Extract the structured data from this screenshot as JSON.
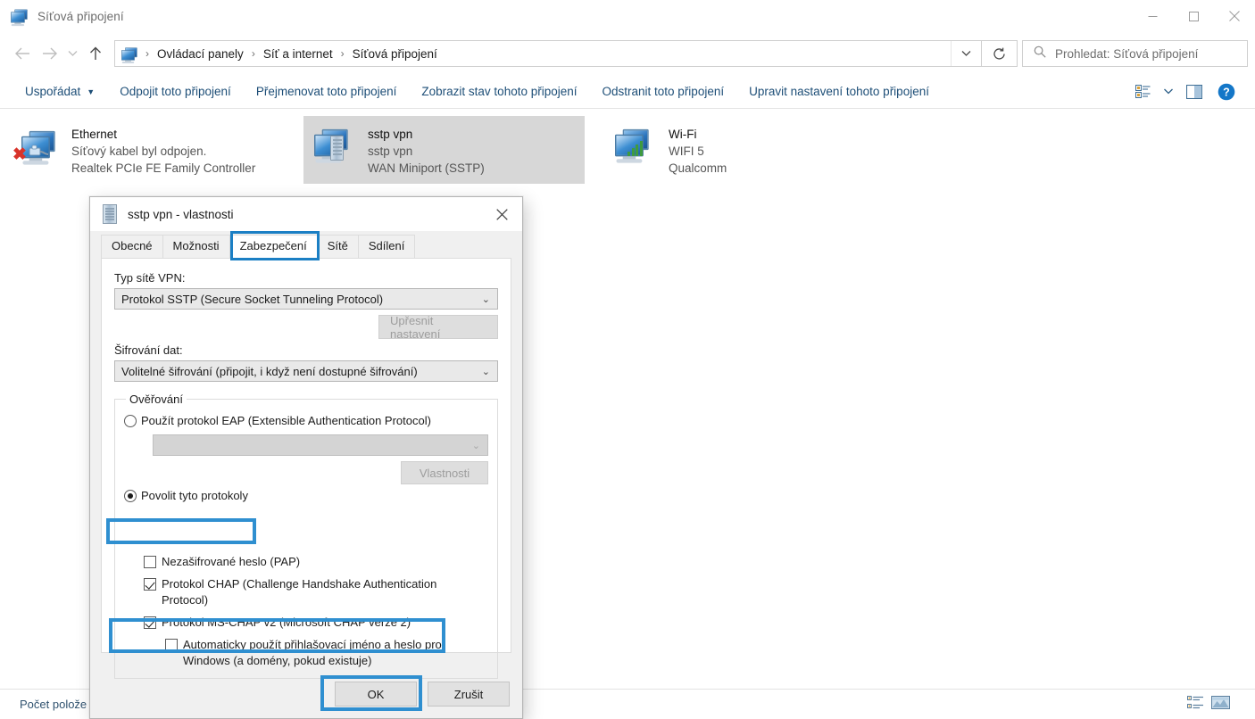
{
  "window": {
    "title": "Síťová připojení",
    "icon": "network-connections-icon",
    "minimize": "minimize-icon",
    "maximize": "maximize-icon",
    "close": "close-icon"
  },
  "address_bar": {
    "back": "back-arrow-icon",
    "forward": "forward-arrow-icon",
    "recent": "chevron-down-icon",
    "up": "up-arrow-icon",
    "crumbs": [
      "Ovládací panely",
      "Síť a internet",
      "Síťová připojení"
    ],
    "separator": "›",
    "dropdown": "chevron-down-icon",
    "refresh": "refresh-icon"
  },
  "search": {
    "icon": "search-icon",
    "placeholder": "Prohledat: Síťová připojení"
  },
  "command_bar": {
    "items": [
      {
        "label": "Uspořádat",
        "has_caret": true
      },
      {
        "label": "Odpojit toto připojení",
        "has_caret": false
      },
      {
        "label": "Přejmenovat toto připojení",
        "has_caret": false
      },
      {
        "label": "Zobrazit stav tohoto připojení",
        "has_caret": false
      },
      {
        "label": "Odstranit toto připojení",
        "has_caret": false
      },
      {
        "label": "Upravit nastavení tohoto připojení",
        "has_caret": false
      }
    ],
    "view_icon": "change-view-icon",
    "view_caret": "chevron-down-icon",
    "pane_icon": "preview-pane-icon",
    "help_icon": "help-icon"
  },
  "connections": [
    {
      "name": "Ethernet",
      "status": "Síťový kabel byl odpojen.",
      "device": "Realtek PCIe FE Family Controller",
      "icon": "network-adapter-disconnected-icon",
      "selected": false
    },
    {
      "name": "sstp vpn",
      "status": "sstp vpn",
      "device": "WAN Miniport (SSTP)",
      "icon": "vpn-connection-icon",
      "selected": true
    },
    {
      "name": "Wi-Fi",
      "status": "WIFI 5",
      "device": "Qualcomm",
      "icon": "wifi-connection-icon",
      "selected": false
    }
  ],
  "status_bar": {
    "text": "Počet polože",
    "details_view_icon": "details-view-icon",
    "tiles_view_icon": "tiles-view-icon"
  },
  "dialog": {
    "title": "sstp vpn - vlastnosti",
    "icon": "vpn-server-icon",
    "close": "close-icon",
    "tabs": [
      {
        "label": "Obecné",
        "active": false
      },
      {
        "label": "Možnosti",
        "active": false
      },
      {
        "label": "Zabezpečení",
        "active": true
      },
      {
        "label": "Sítě",
        "active": false
      },
      {
        "label": "Sdílení",
        "active": false
      }
    ],
    "vpn_type_label": "Typ sítě VPN:",
    "vpn_type_value": "Protokol SSTP (Secure Socket Tunneling Protocol)",
    "advanced_button": "Upřesnit nastavení",
    "encryption_label": "Šifrování dat:",
    "encryption_value": "Volitelné šifrování (připojit, i když není dostupné šifrování)",
    "auth_group_label": "Ověřování",
    "eap_radio_label": "Použít protokol EAP (Extensible Authentication Protocol)",
    "eap_combo_value": "",
    "eap_properties_button": "Vlastnosti",
    "allow_protocols_radio_label": "Povolit tyto protokoly",
    "protocols": [
      {
        "label": "Nezašifrované heslo (PAP)",
        "checked": false,
        "indent": false,
        "highlighted": false
      },
      {
        "label": "Protokol CHAP (Challenge Handshake Authentication Protocol)",
        "checked": true,
        "indent": false,
        "highlighted": true
      },
      {
        "label": "Protokol MS-CHAP v2 (Microsoft CHAP verze 2)",
        "checked": true,
        "indent": false,
        "highlighted": false
      },
      {
        "label": "Automaticky použít přihlašovací jméno a heslo pro Windows (a domény, pokud existuje)",
        "checked": false,
        "indent": true,
        "highlighted": false
      }
    ],
    "ok_button": "OK",
    "cancel_button": "Zrušit"
  },
  "colors": {
    "highlight": "#2f8fd0",
    "tab_highlight": "#1b7fc4",
    "command_link": "#1d4e77",
    "selection": "#d7d7d7"
  }
}
